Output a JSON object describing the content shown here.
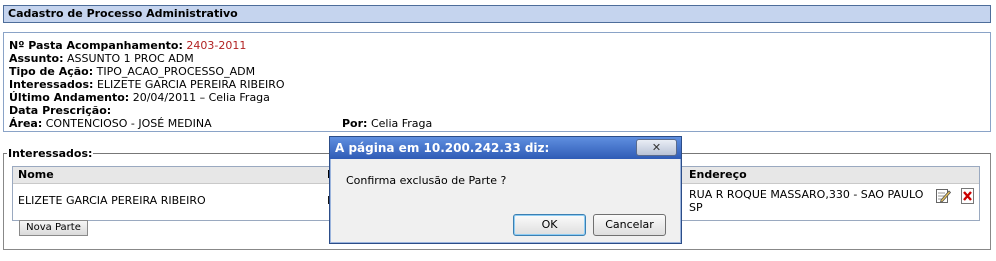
{
  "header": {
    "title": "Cadastro de Processo Administrativo"
  },
  "info": {
    "pasta_label": "Nº Pasta Acompanhamento:",
    "pasta_value": "2403-2011",
    "assunto_label": "Assunto:",
    "assunto_value": "ASSUNTO 1 PROC ADM",
    "tipo_label": "Tipo de Ação:",
    "tipo_value": "TIPO_ACAO_PROCESSO_ADM",
    "interessados_label": "Interessados:",
    "interessados_value": "ELIZETE GARCIA PEREIRA RIBEIRO",
    "andamento_label": "Último Andamento:",
    "andamento_value": "20/04/2011 – Celia Fraga",
    "prescricao_label": "Data Prescrição:",
    "area_label": "Área:",
    "area_value": "CONTENCIOSO - JOSÉ MEDINA",
    "por_label": "Por:",
    "por_value": "Celia Fraga"
  },
  "interessados": {
    "legend": "Interessados:",
    "columns": {
      "nome": "Nome",
      "col2": "I",
      "endereco": "Endereço"
    },
    "rows": [
      {
        "nome": "ELIZETE GARCIA PEREIRA RIBEIRO",
        "col2": "I",
        "endereco_line1": "RUA R ROQUE MASSARO,330 - SAO PAULO",
        "endereco_line2": "SP"
      }
    ],
    "nova_parte_label": "Nova Parte"
  },
  "dialog": {
    "title": "A página em 10.200.242.33 diz:",
    "message": "Confirma exclusão de Parte ?",
    "ok_label": "OK",
    "cancel_label": "Cancelar",
    "close_icon": "close-icon"
  },
  "colors": {
    "header_bg": "#c5d4ee",
    "title_bar": "#2f5bb5",
    "pasta_value": "#b22222",
    "delete_icon": "#cc0000"
  }
}
